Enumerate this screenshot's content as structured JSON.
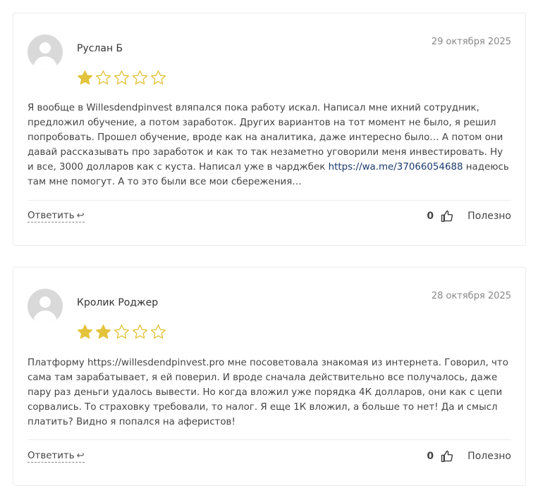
{
  "reviews": [
    {
      "author": "Руслан Б",
      "date": "29 октября 2025",
      "rating": 1,
      "max_rating": 5,
      "text_before_link": "Я вообще в Willesdendpinvest вляпался пока работу искал. Написал мне ихний сотрудник, предложил обучение, а потом заработок. Других вариантов на тот момент не было, я решил попробовать. Прошел обучение, вроде как на аналитика, даже интересно было… А потом они давай рассказывать про заработок и как то так незаметно уговорили меня инвестировать. Ну и все, 3000 долларов как с куста. Написал уже в чарджбек ",
      "link_text": "https://wa.me/37066054688",
      "text_after_link": " надеюсь там мне помогут. А то это были все мои сбережения…",
      "reply_label": "Ответить",
      "helpful_count": "0",
      "helpful_label": "Полезно"
    },
    {
      "author": "Кролик Роджер",
      "date": "28 октября 2025",
      "rating": 2,
      "max_rating": 5,
      "text": "Платформу https://willesdendpinvest.pro мне посоветовала знакомая из интернета. Говорил, что сама там зарабатывает, я ей поверил. И вроде сначала действительно все получалось, даже пару раз деньги удалось вывести. Но когда вложил уже порядка 4К долларов, они как с цепи сорвались. То страховку требовали, то налог. Я еще 1К вложил, а больше то нет! Да и смысл платить? Видно я попался на аферистов!",
      "reply_label": "Ответить",
      "helpful_count": "0",
      "helpful_label": "Полезно"
    }
  ],
  "icons": {
    "avatar": "user-placeholder-icon",
    "star_filled": "star-filled-icon",
    "star_empty": "star-outline-icon",
    "reply": "reply-arrow-icon",
    "thumb": "thumbs-up-icon"
  },
  "colors": {
    "star": "#e3c33b",
    "link": "#1a3a6b",
    "border": "#ececec"
  }
}
